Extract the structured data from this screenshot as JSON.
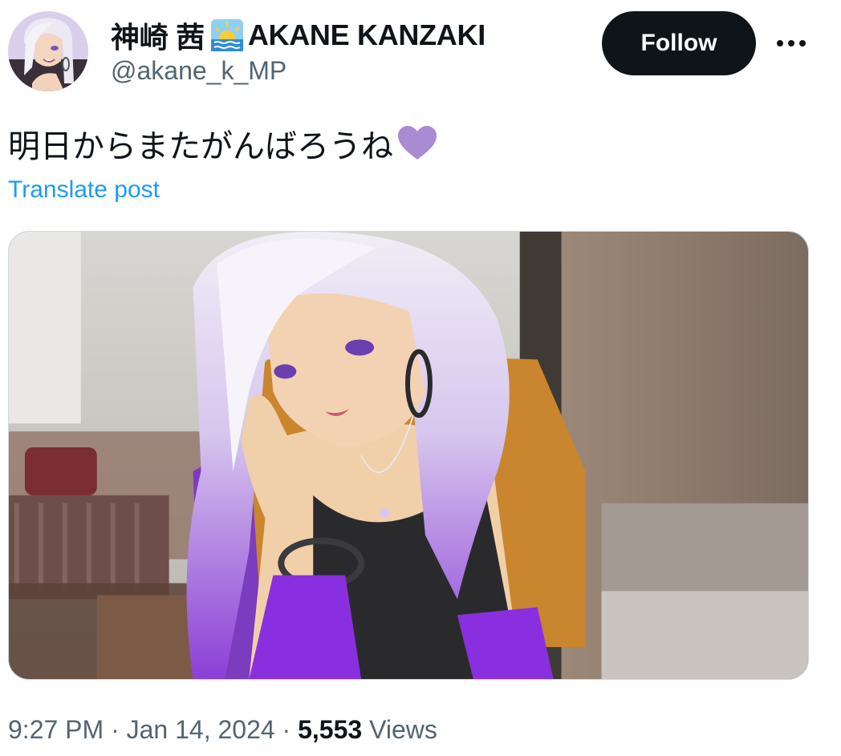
{
  "author": {
    "display_name": "神崎 茜",
    "display_name_suffix": "AKANE KANZAKI",
    "name_emoji": "sunrise-over-water-icon",
    "handle": "@akane_k_MP",
    "avatar": "avatar-image"
  },
  "actions": {
    "follow_label": "Follow",
    "more_icon": "more-dots-icon"
  },
  "post": {
    "text": "明日からまたがんばろうね",
    "emoji": "purple-heart-icon",
    "translate_label": "Translate post"
  },
  "media": {
    "image": "anime-character-with-lavender-hair-leaning-by-doorway"
  },
  "meta": {
    "time": "9:27 PM",
    "separator": "·",
    "date": "Jan 14, 2024",
    "views_count": "5,553",
    "views_label": "Views"
  },
  "colors": {
    "text_primary": "#0f1419",
    "text_secondary": "#536471",
    "link": "#1d9bf0",
    "follow_bg": "#0f1419",
    "heart": "#a98bd4"
  }
}
